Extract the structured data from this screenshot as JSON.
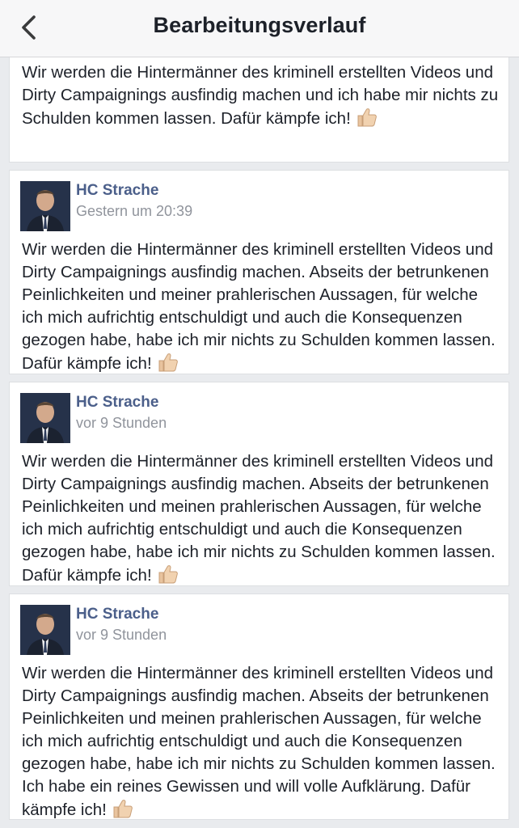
{
  "navbar": {
    "title": "Bearbeitungsverlauf",
    "back_icon": "chevron-left-icon"
  },
  "colors": {
    "author_link": "#4b5f8a",
    "timestamp": "#90949c",
    "page_background": "#e9ebee",
    "thumb_emoji": "#f1d2b0"
  },
  "entries": [
    {
      "text": "Wir werden die Hintermänner des kriminell erstellten Videos und Dirty Campaignings ausfindig machen und ich habe mir nichts zu Schulden kommen lassen. Dafür kämpfe ich!",
      "emoji": "thumbs-up-icon"
    },
    {
      "author": "HC Strache",
      "time": "Gestern um 20:39",
      "text": "Wir werden die Hintermänner des kriminell erstellten Videos und Dirty Campaignings ausfindig machen. Abseits der betrunkenen Peinlichkeiten und meiner prahlerischen Aussagen, für welche ich mich aufrichtig entschuldigt und auch die Konsequenzen gezogen habe, habe ich mir nichts zu Schulden kommen lassen. Dafür kämpfe ich!",
      "emoji": "thumbs-up-icon"
    },
    {
      "author": "HC Strache",
      "time": "vor 9 Stunden",
      "text": "Wir werden die Hintermänner des kriminell erstellten Videos und Dirty Campaignings ausfindig machen. Abseits der betrunkenen Peinlichkeiten und meinen prahlerischen Aussagen, für welche ich mich aufrichtig entschuldigt und auch die Konsequenzen gezogen habe, habe ich mir nichts zu Schulden kommen lassen. Dafür kämpfe ich!",
      "emoji": "thumbs-up-icon"
    },
    {
      "author": "HC Strache",
      "time": "vor 9 Stunden",
      "text": "Wir werden die Hintermänner des kriminell erstellten Videos und Dirty Campaignings ausfindig machen. Abseits der betrunkenen Peinlichkeiten und meinen prahlerischen Aussagen, für welche ich mich aufrichtig entschuldigt und auch die Konsequenzen gezogen habe, habe ich mir nichts zu Schulden kommen lassen. Ich habe ein reines Gewissen und will volle Aufklärung. Dafür kämpfe ich!",
      "emoji": "thumbs-up-icon"
    }
  ]
}
